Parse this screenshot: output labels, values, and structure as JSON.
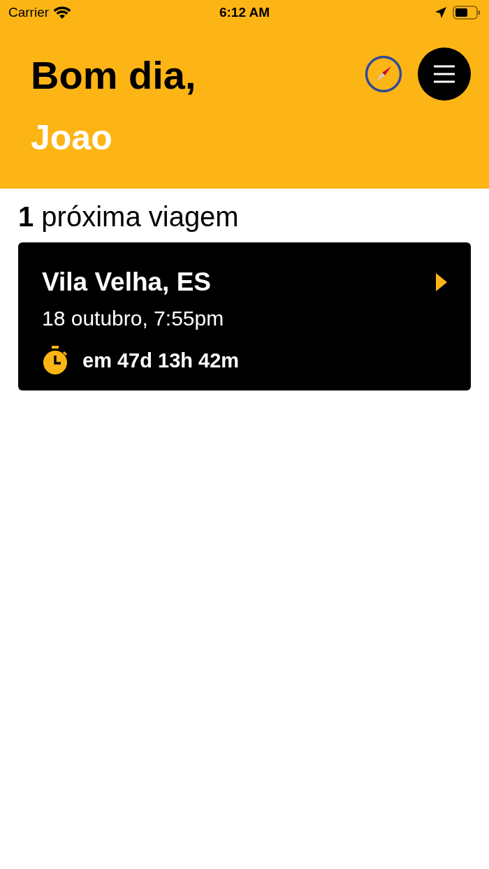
{
  "status_bar": {
    "carrier": "Carrier",
    "time": "6:12 AM"
  },
  "header": {
    "greeting": "Bom dia,",
    "name": "Joao"
  },
  "trips_heading": "**1** próxima viagem",
  "trips": [
    {
      "city": "Vila Velha, ES",
      "date": "18 outubro, 7:55pm",
      "countdown": "em 47d 13h 42m"
    }
  ]
}
